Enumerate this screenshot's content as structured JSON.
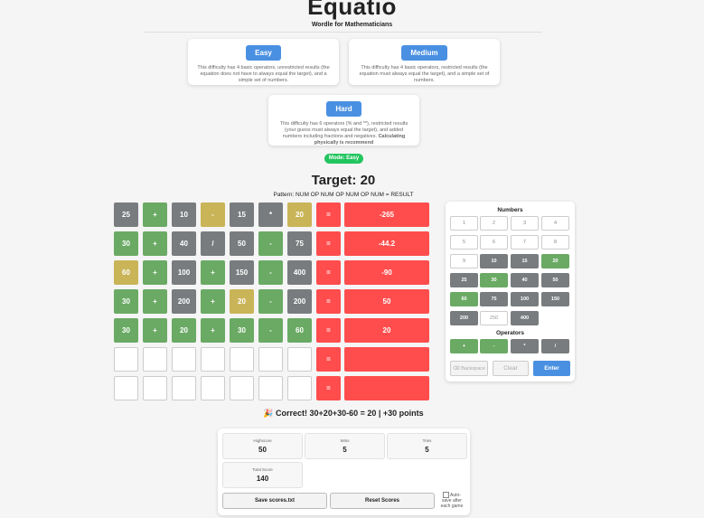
{
  "header": {
    "title": "Equatio",
    "subtitle": "Wordle for Mathematicians"
  },
  "difficulties": [
    {
      "label": "Easy",
      "description": "This difficulty has 4 basic operators, unrestricted results (the equation does not have to always equal the target), and a simple set of numbers."
    },
    {
      "label": "Medium",
      "description": "This difficulty has 4 basic operators, restricted results (the equation must always equal the target), and a simple set of numbers."
    },
    {
      "label": "Hard",
      "description": "This difficulty has 6 operators (% and **), restricted results (your guess must always equal the target), and added numbers including fractions and negatives.",
      "note": "Calculating physically is recommend"
    }
  ],
  "mode_badge": "Mode: Easy",
  "target_label": "Target: 20",
  "pattern": "Pattern: NUM OP NUM OP NUM OP NUM = RESULT",
  "equals_sign": "=",
  "rows": [
    {
      "cells": [
        {
          "t": "25",
          "s": "grey"
        },
        {
          "t": "+",
          "s": "green"
        },
        {
          "t": "10",
          "s": "grey"
        },
        {
          "t": "-",
          "s": "yellow"
        },
        {
          "t": "15",
          "s": "grey"
        },
        {
          "t": "*",
          "s": "grey"
        },
        {
          "t": "20",
          "s": "yellow"
        }
      ],
      "result": "-265"
    },
    {
      "cells": [
        {
          "t": "30",
          "s": "green"
        },
        {
          "t": "+",
          "s": "green"
        },
        {
          "t": "40",
          "s": "grey"
        },
        {
          "t": "/",
          "s": "grey"
        },
        {
          "t": "50",
          "s": "grey"
        },
        {
          "t": "-",
          "s": "green"
        },
        {
          "t": "75",
          "s": "grey"
        }
      ],
      "result": "-44.2"
    },
    {
      "cells": [
        {
          "t": "60",
          "s": "yellow"
        },
        {
          "t": "+",
          "s": "green"
        },
        {
          "t": "100",
          "s": "grey"
        },
        {
          "t": "+",
          "s": "green"
        },
        {
          "t": "150",
          "s": "grey"
        },
        {
          "t": "-",
          "s": "green"
        },
        {
          "t": "400",
          "s": "grey"
        }
      ],
      "result": "-90"
    },
    {
      "cells": [
        {
          "t": "30",
          "s": "green"
        },
        {
          "t": "+",
          "s": "green"
        },
        {
          "t": "200",
          "s": "grey"
        },
        {
          "t": "+",
          "s": "green"
        },
        {
          "t": "20",
          "s": "yellow"
        },
        {
          "t": "-",
          "s": "green"
        },
        {
          "t": "200",
          "s": "grey"
        }
      ],
      "result": "50"
    },
    {
      "cells": [
        {
          "t": "30",
          "s": "green"
        },
        {
          "t": "+",
          "s": "green"
        },
        {
          "t": "20",
          "s": "green"
        },
        {
          "t": "+",
          "s": "green"
        },
        {
          "t": "30",
          "s": "green"
        },
        {
          "t": "-",
          "s": "green"
        },
        {
          "t": "60",
          "s": "green"
        }
      ],
      "result": "20"
    },
    {
      "cells": [
        {
          "t": "",
          "s": "empty"
        },
        {
          "t": "",
          "s": "empty"
        },
        {
          "t": "",
          "s": "empty"
        },
        {
          "t": "",
          "s": "empty"
        },
        {
          "t": "",
          "s": "empty"
        },
        {
          "t": "",
          "s": "empty"
        },
        {
          "t": "",
          "s": "empty"
        }
      ],
      "result": ""
    },
    {
      "cells": [
        {
          "t": "",
          "s": "empty"
        },
        {
          "t": "",
          "s": "empty"
        },
        {
          "t": "",
          "s": "empty"
        },
        {
          "t": "",
          "s": "empty"
        },
        {
          "t": "",
          "s": "empty"
        },
        {
          "t": "",
          "s": "empty"
        },
        {
          "t": "",
          "s": "empty"
        }
      ],
      "result": ""
    }
  ],
  "keypad": {
    "numbers_title": "Numbers",
    "numbers": [
      {
        "t": "1",
        "s": "empty"
      },
      {
        "t": "2",
        "s": "empty"
      },
      {
        "t": "3",
        "s": "empty"
      },
      {
        "t": "4",
        "s": "empty"
      },
      {
        "t": "5",
        "s": "empty"
      },
      {
        "t": "6",
        "s": "empty"
      },
      {
        "t": "7",
        "s": "empty"
      },
      {
        "t": "8",
        "s": "empty"
      },
      {
        "t": "9",
        "s": "empty"
      },
      {
        "t": "10",
        "s": "dark"
      },
      {
        "t": "15",
        "s": "dark"
      },
      {
        "t": "20",
        "s": "green"
      },
      {
        "t": "25",
        "s": "dark"
      },
      {
        "t": "30",
        "s": "green"
      },
      {
        "t": "40",
        "s": "dark"
      },
      {
        "t": "50",
        "s": "dark"
      },
      {
        "t": "60",
        "s": "green"
      },
      {
        "t": "75",
        "s": "dark"
      },
      {
        "t": "100",
        "s": "dark"
      },
      {
        "t": "150",
        "s": "dark"
      },
      {
        "t": "200",
        "s": "dark"
      },
      {
        "t": "250",
        "s": "lightborder"
      },
      {
        "t": "400",
        "s": "dark"
      }
    ],
    "operators_title": "Operators",
    "operators": [
      {
        "t": "+",
        "s": "green"
      },
      {
        "t": "-",
        "s": "green"
      },
      {
        "t": "*",
        "s": "dark"
      },
      {
        "t": "/",
        "s": "dark"
      }
    ],
    "backspace_label": "⌫ Backspace",
    "clear_label": "Clear",
    "enter_label": "Enter"
  },
  "message": "🎉 Correct! 30+20+30-60 = 20 | +30 points",
  "stats": {
    "highscore": {
      "label": "Highscore",
      "value": "50"
    },
    "wins": {
      "label": "Wins",
      "value": "5"
    },
    "tries": {
      "label": "Tries",
      "value": "5"
    },
    "total": {
      "label": "Total Score",
      "value": "140"
    }
  },
  "save_label": "Save scores.txt",
  "reset_label": "Reset Scores",
  "autosave_label": "Auto-save after each game",
  "colors": {
    "grey": "#787c7e",
    "green": "#6aaa64",
    "yellow": "#c9b458",
    "red": "#ff4d4d",
    "blue": "#4a90e2",
    "mode": "#22c55e"
  }
}
